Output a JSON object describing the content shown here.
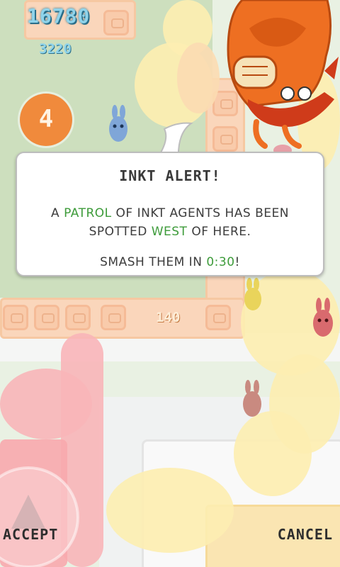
{
  "hud": {
    "score": "16780",
    "sub_score": "3220",
    "counter": "4",
    "floating_points": "140"
  },
  "alert": {
    "title": "INKT ALERT!",
    "line1_a": "A ",
    "line1_patrol": "PATROL",
    "line1_b": " OF INKT AGENTS HAS BEEN",
    "line2_a": "SPOTTED ",
    "line2_dir": "WEST",
    "line2_b": " OF HERE.",
    "timer_prefix": "SMASH THEM IN ",
    "timer_value": "0:30",
    "timer_suffix": "!"
  },
  "buttons": {
    "accept": "ACCEPT",
    "cancel": "CANCEL"
  },
  "colors": {
    "highlight": "#3d9b3a",
    "hud_text": "#8fd3ea",
    "hero_orange": "#ee6f22"
  }
}
